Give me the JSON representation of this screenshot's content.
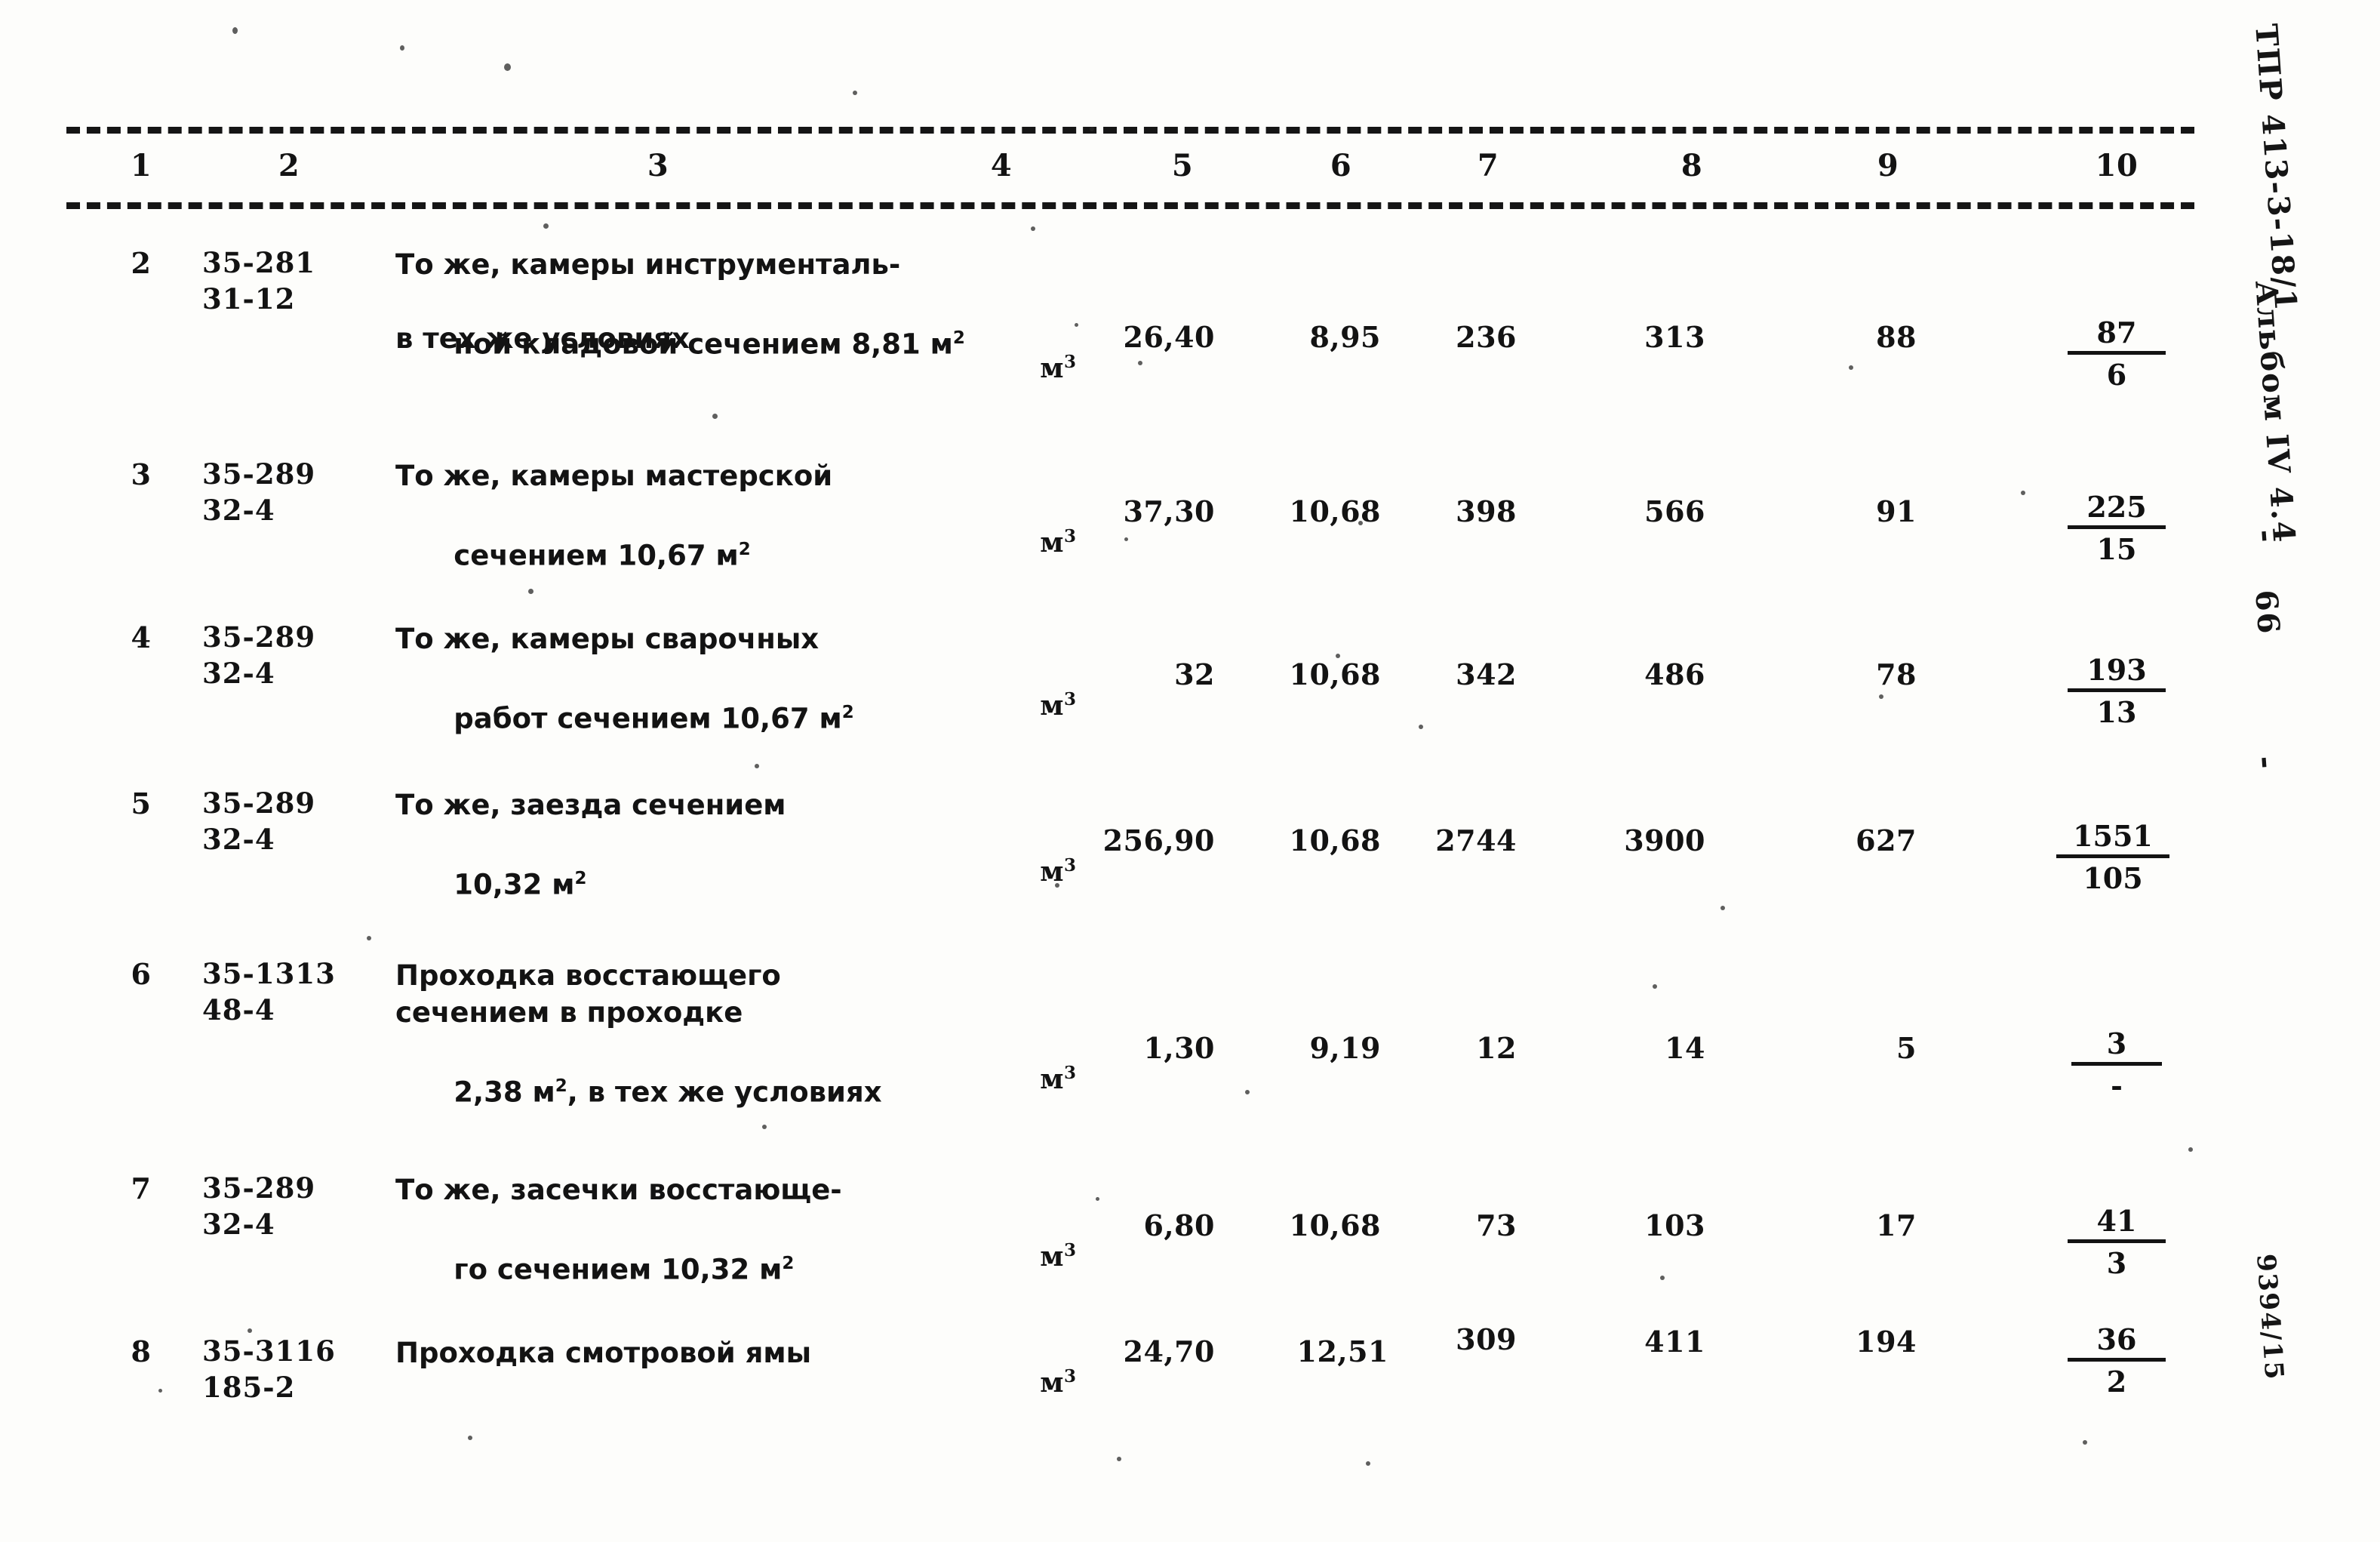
{
  "document": {
    "kind": "scanned-estimate-table",
    "language": "ru"
  },
  "table": {
    "column_headers": [
      "1",
      "2",
      "3",
      "4",
      "5",
      "6",
      "7",
      "8",
      "9",
      "10"
    ],
    "rows": [
      {
        "no": "2",
        "code_top": "35-281",
        "code_bottom": "31-12",
        "desc_line1": "То же, камеры инструменталь-",
        "desc_line2": "ной кладовой сечением 8,81 м",
        "desc_line2_sup": "2",
        "desc_line3": "в тех же условиях",
        "unit": "м",
        "unit_sup": "3",
        "c5": "26,40",
        "c6": "8,95",
        "c7": "236",
        "c8": "313",
        "c9": "88",
        "c10_top": "87",
        "c10_bottom": "6"
      },
      {
        "no": "3",
        "code_top": "35-289",
        "code_bottom": "32-4",
        "desc_line1": "То же, камеры мастерской",
        "desc_line2": "сечением 10,67 м",
        "desc_line2_sup": "2",
        "desc_line3": "",
        "unit": "м",
        "unit_sup": "3",
        "c5": "37,30",
        "c6": "10,68",
        "c7": "398",
        "c8": "566",
        "c9": "91",
        "c10_top": "225",
        "c10_bottom": "15"
      },
      {
        "no": "4",
        "code_top": "35-289",
        "code_bottom": "32-4",
        "desc_line1": "То же, камеры сварочных",
        "desc_line2": "работ сечением 10,67 м",
        "desc_line2_sup": "2",
        "desc_line3": "",
        "unit": "м",
        "unit_sup": "3",
        "c5": "32",
        "c6": "10,68",
        "c7": "342",
        "c8": "486",
        "c9": "78",
        "c10_top": "193",
        "c10_bottom": "13"
      },
      {
        "no": "5",
        "code_top": "35-289",
        "code_bottom": "32-4",
        "desc_line1": "То же, заезда сечением",
        "desc_line2": "10,32 м",
        "desc_line2_sup": "2",
        "desc_line3": "",
        "unit": "м",
        "unit_sup": "3",
        "c5": "256,90",
        "c6": "10,68",
        "c7": "2744",
        "c8": "3900",
        "c9": "627",
        "c10_top": "1551",
        "c10_bottom": "105"
      },
      {
        "no": "6",
        "code_top": "35-1313",
        "code_bottom": "48-4",
        "desc_line1": "Проходка восстающего",
        "desc_line2": "сечением в проходке",
        "desc_line2_sup": "",
        "desc_line3": "2,38 м",
        "desc_line3_sup": "2",
        "desc_line3_tail": ", в тех же условиях",
        "unit": "м",
        "unit_sup": "3",
        "c5": "1,30",
        "c6": "9,19",
        "c7": "12",
        "c8": "14",
        "c9": "5",
        "c10_top": "3",
        "c10_bottom": "-"
      },
      {
        "no": "7",
        "code_top": "35-289",
        "code_bottom": "32-4",
        "desc_line1": "То же, засечки восстающе-",
        "desc_line2": "го сечением 10,32 м",
        "desc_line2_sup": "2",
        "desc_line3": "",
        "unit": "м",
        "unit_sup": "3",
        "c5": "6,80",
        "c6": "10,68",
        "c7": "73",
        "c8": "103",
        "c9": "17",
        "c10_top": "41",
        "c10_bottom": "3"
      },
      {
        "no": "8",
        "code_top": "35-3116",
        "code_bottom": "185-2",
        "desc_line1": "Проходка смотровой ямы",
        "desc_line2": "",
        "desc_line2_sup": "",
        "desc_line3": "",
        "unit": "м",
        "unit_sup": "3",
        "c5": "24,70",
        "c6": "12,51",
        "c7": "309",
        "c8": "411",
        "c9": "194",
        "c10_top": "36",
        "c10_bottom": "2"
      }
    ]
  },
  "margin": {
    "series_label": "ТПР 413-3-18/1",
    "album_label": "Альбом IV 4.4",
    "page_number": "66",
    "dash_left": "-",
    "dash_right": "-",
    "archive_code": "9394/15"
  }
}
